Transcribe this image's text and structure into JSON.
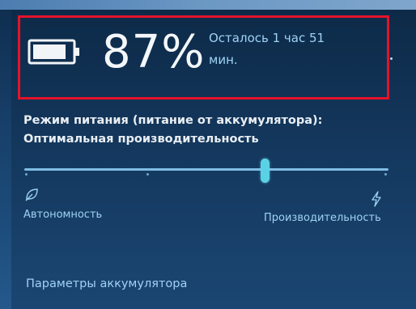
{
  "battery": {
    "icon": "battery-icon",
    "percent_text": "87%",
    "level": 0.87,
    "remaining_text": "Осталось 1 час 51 мин."
  },
  "power_mode": {
    "title_line1": "Режим питания (питание от аккумулятора):",
    "title_line2": "Оптимальная производительность",
    "slider": {
      "position": 0.66,
      "left_label": "Автономность",
      "left_icon": "leaf-icon",
      "right_label": "Производительность",
      "right_icon": "lightning-bolt-icon"
    }
  },
  "settings_link": "Параметры аккумулятора",
  "colors": {
    "accent": "#9fd2f4",
    "thumb": "#5ad2e6",
    "highlight_box": "#e4132b",
    "panel": "#153a61"
  }
}
